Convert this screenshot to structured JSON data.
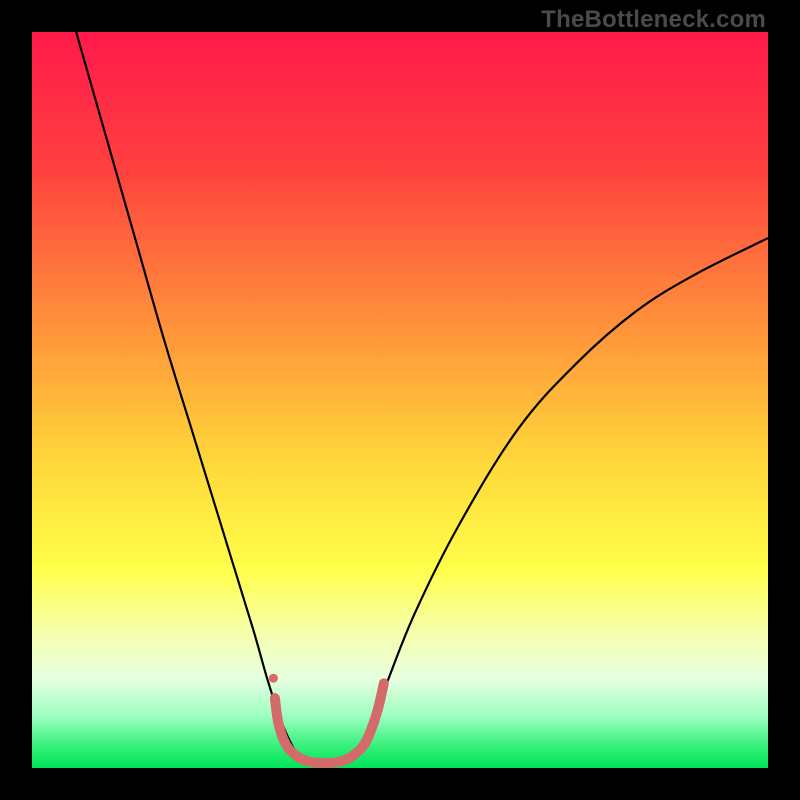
{
  "watermark": {
    "text": "TheBottleneck.com"
  },
  "chart_data": {
    "type": "line",
    "title": "",
    "xlabel": "",
    "ylabel": "",
    "xlim": [
      0,
      100
    ],
    "ylim": [
      0,
      100
    ],
    "grid": false,
    "legend": false,
    "gradient_stops": [
      {
        "offset": 0,
        "color": "#ff1a4b"
      },
      {
        "offset": 18,
        "color": "#ff3f3f"
      },
      {
        "offset": 40,
        "color": "#ff923a"
      },
      {
        "offset": 58,
        "color": "#ffd63a"
      },
      {
        "offset": 73,
        "color": "#ffff4a"
      },
      {
        "offset": 82,
        "color": "#f6ffb0"
      },
      {
        "offset": 88,
        "color": "#e6ffe0"
      },
      {
        "offset": 93,
        "color": "#9cffc0"
      },
      {
        "offset": 97,
        "color": "#36f07a"
      },
      {
        "offset": 100,
        "color": "#00e45a"
      }
    ],
    "series": [
      {
        "name": "curve",
        "color": "#000000",
        "width": 2.2,
        "points": [
          {
            "x": 6,
            "y": 100
          },
          {
            "x": 10,
            "y": 86
          },
          {
            "x": 14,
            "y": 72
          },
          {
            "x": 18,
            "y": 58
          },
          {
            "x": 22,
            "y": 45
          },
          {
            "x": 26,
            "y": 32
          },
          {
            "x": 30,
            "y": 19
          },
          {
            "x": 32,
            "y": 12
          },
          {
            "x": 34,
            "y": 6
          },
          {
            "x": 36,
            "y": 2
          },
          {
            "x": 38,
            "y": 0.6
          },
          {
            "x": 40,
            "y": 0.4
          },
          {
            "x": 42,
            "y": 0.6
          },
          {
            "x": 44,
            "y": 2
          },
          {
            "x": 46,
            "y": 6
          },
          {
            "x": 48,
            "y": 11
          },
          {
            "x": 52,
            "y": 21
          },
          {
            "x": 58,
            "y": 33
          },
          {
            "x": 66,
            "y": 46
          },
          {
            "x": 74,
            "y": 55
          },
          {
            "x": 82,
            "y": 62
          },
          {
            "x": 90,
            "y": 67
          },
          {
            "x": 100,
            "y": 72
          }
        ]
      },
      {
        "name": "marker-trail",
        "color": "#d46a6a",
        "width": 10,
        "dot_radius": 4.5,
        "points": [
          {
            "x": 33.0,
            "y": 9.5
          },
          {
            "x": 33.5,
            "y": 6.0
          },
          {
            "x": 34.5,
            "y": 3.2
          },
          {
            "x": 36.0,
            "y": 1.6
          },
          {
            "x": 37.5,
            "y": 0.9
          },
          {
            "x": 39.0,
            "y": 0.7
          },
          {
            "x": 40.5,
            "y": 0.7
          },
          {
            "x": 42.0,
            "y": 0.9
          },
          {
            "x": 43.5,
            "y": 1.6
          },
          {
            "x": 45.0,
            "y": 3.0
          },
          {
            "x": 46.0,
            "y": 5.0
          },
          {
            "x": 47.0,
            "y": 8.0
          },
          {
            "x": 47.8,
            "y": 11.5
          }
        ]
      }
    ]
  }
}
